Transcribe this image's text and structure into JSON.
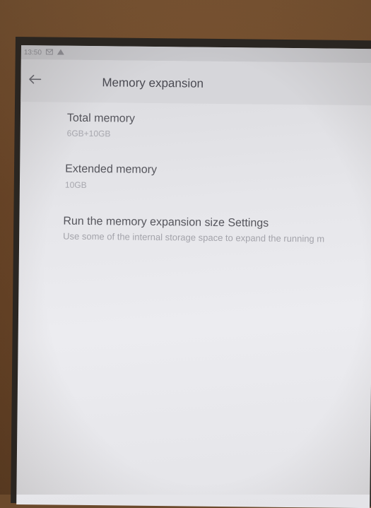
{
  "status_bar": {
    "time": "13:50",
    "icons": [
      "notification-icon",
      "warning-icon"
    ]
  },
  "app_bar": {
    "title": "Memory expansion",
    "back_icon": "arrow-left-icon"
  },
  "settings": {
    "total_memory": {
      "title": "Total memory",
      "value": "6GB+10GB"
    },
    "extended_memory": {
      "title": "Extended memory",
      "value": "10GB"
    },
    "run_expansion": {
      "title": "Run the memory expansion size Settings",
      "summary": "Use some of the internal storage space to expand the running m"
    }
  }
}
